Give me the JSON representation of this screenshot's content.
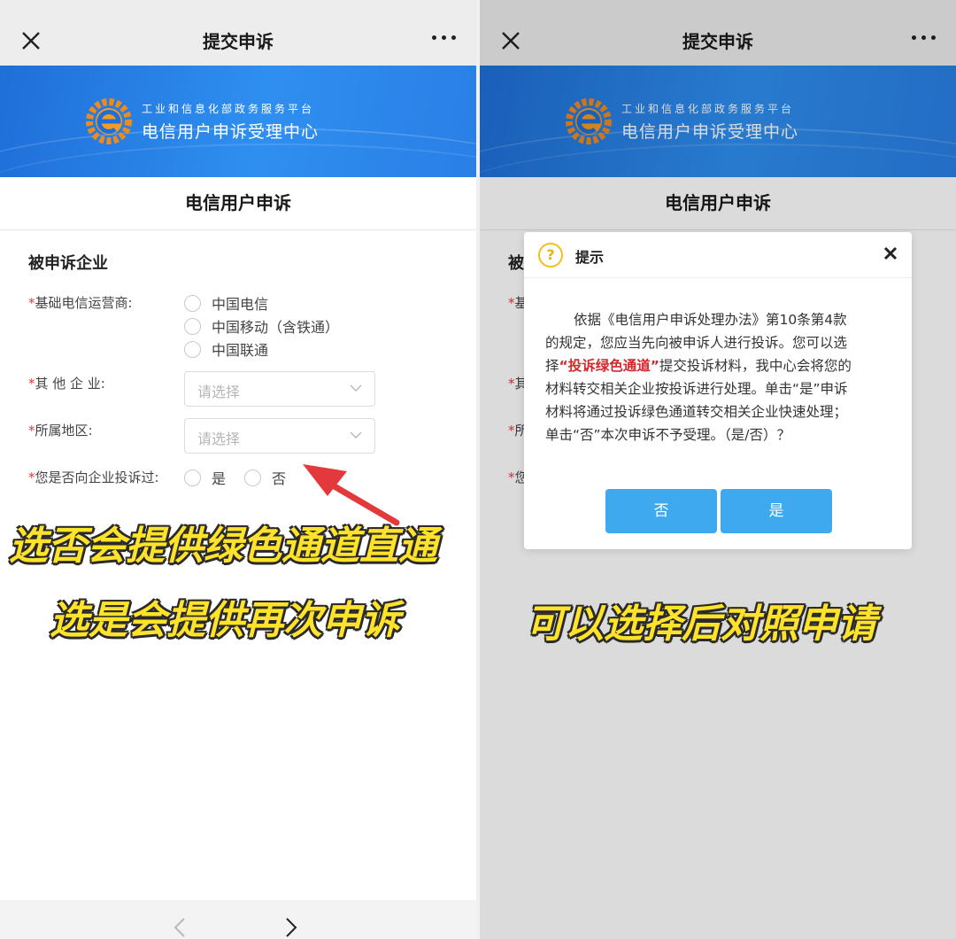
{
  "header": {
    "title": "提交申诉"
  },
  "banner": {
    "subtitle": "工业和信息化部政务服务平台",
    "name": "电信用户申诉受理中心"
  },
  "form": {
    "title": "电信用户申诉",
    "section": "被申诉企业",
    "operator_label": "基础电信运营商:",
    "operators": [
      "中国电信",
      "中国移动（含铁通）",
      "中国联通"
    ],
    "other_label": "其 他 企 业:",
    "other_placeholder": "请选择",
    "region_label": "所属地区:",
    "region_placeholder": "请选择",
    "complained_label": "您是否向企业投诉过:",
    "yes": "是",
    "no": "否",
    "required_mark": "*"
  },
  "captions": {
    "line1": "选否会提供绿色通道直通",
    "line2": "选是会提供再次申诉",
    "line3": "可以选择后对照申请"
  },
  "right_visible": {
    "section_frag": "被",
    "frag1": "基",
    "frag2": "其",
    "frag3": "所",
    "frag4": "您"
  },
  "dialog": {
    "title": "提示",
    "line1": "依据《电信用户申诉处理办法》第10条第4款",
    "line2": "的规定，您应当先向被申诉人进行投诉。您可以选",
    "line3_a": "择",
    "line3_red": "“投诉绿色通道”",
    "line3_b": "提交投诉材料，我中心会将您的",
    "line4": "材料转交相关企业按投诉进行处理。单击“是”申诉",
    "line5": "材料将通过投诉绿色通道转交相关企业快速处理；",
    "line6": "单击“否”本次申诉不予受理。（是/否）？",
    "no_label": "否",
    "yes_label": "是"
  },
  "colors": {
    "accent": "#3fa9f0",
    "required": "#e4393c",
    "caption": "#ffe22a",
    "banner": "#2a85ea"
  }
}
